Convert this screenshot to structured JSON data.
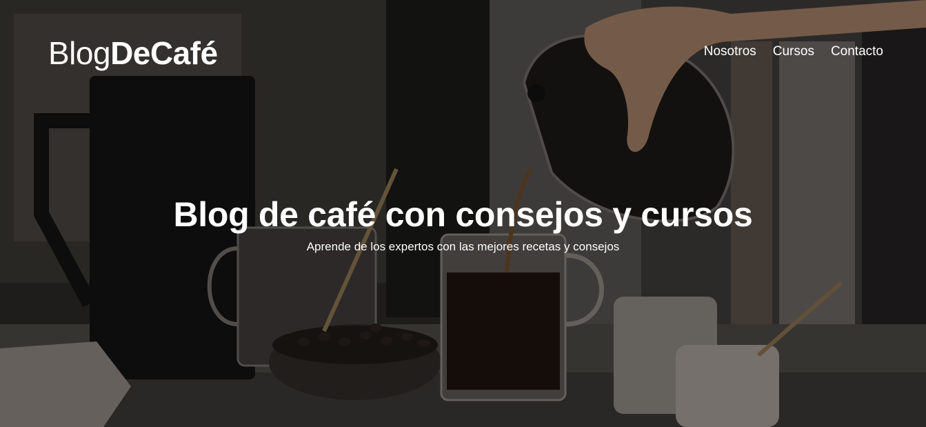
{
  "header": {
    "logo": {
      "part_light": "Blog",
      "part_bold": "DeCafé"
    },
    "nav": [
      {
        "label": "Nosotros"
      },
      {
        "label": "Cursos"
      },
      {
        "label": "Contacto"
      }
    ]
  },
  "hero": {
    "title": "Blog de café con consejos y cursos",
    "subtitle": "Aprende de los expertos con las mejores recetas y consejos",
    "background": "coffee-pouring-photo"
  },
  "colors": {
    "text": "#ffffff",
    "overlay": "#000000"
  }
}
